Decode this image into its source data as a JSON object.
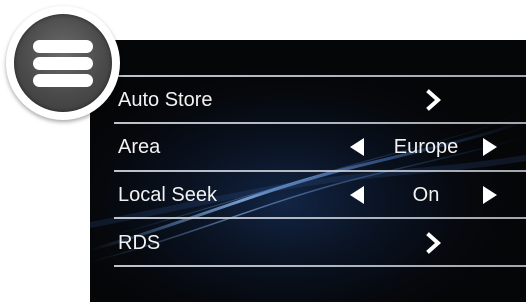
{
  "menu": {
    "icon": "hamburger-menu-icon"
  },
  "settings": {
    "rows": [
      {
        "label": "Auto Store",
        "control": "chevron"
      },
      {
        "label": "Area",
        "control": "selector",
        "value": "Europe"
      },
      {
        "label": "Local Seek",
        "control": "selector",
        "value": "On"
      },
      {
        "label": "RDS",
        "control": "chevron"
      }
    ]
  },
  "colors": {
    "panel_background": "#050608",
    "text": "#f2f2f2",
    "divider": "#d2d7e1",
    "accent_glow": "#2a5fa8",
    "menu_button_fill": "#4a4a4a"
  }
}
